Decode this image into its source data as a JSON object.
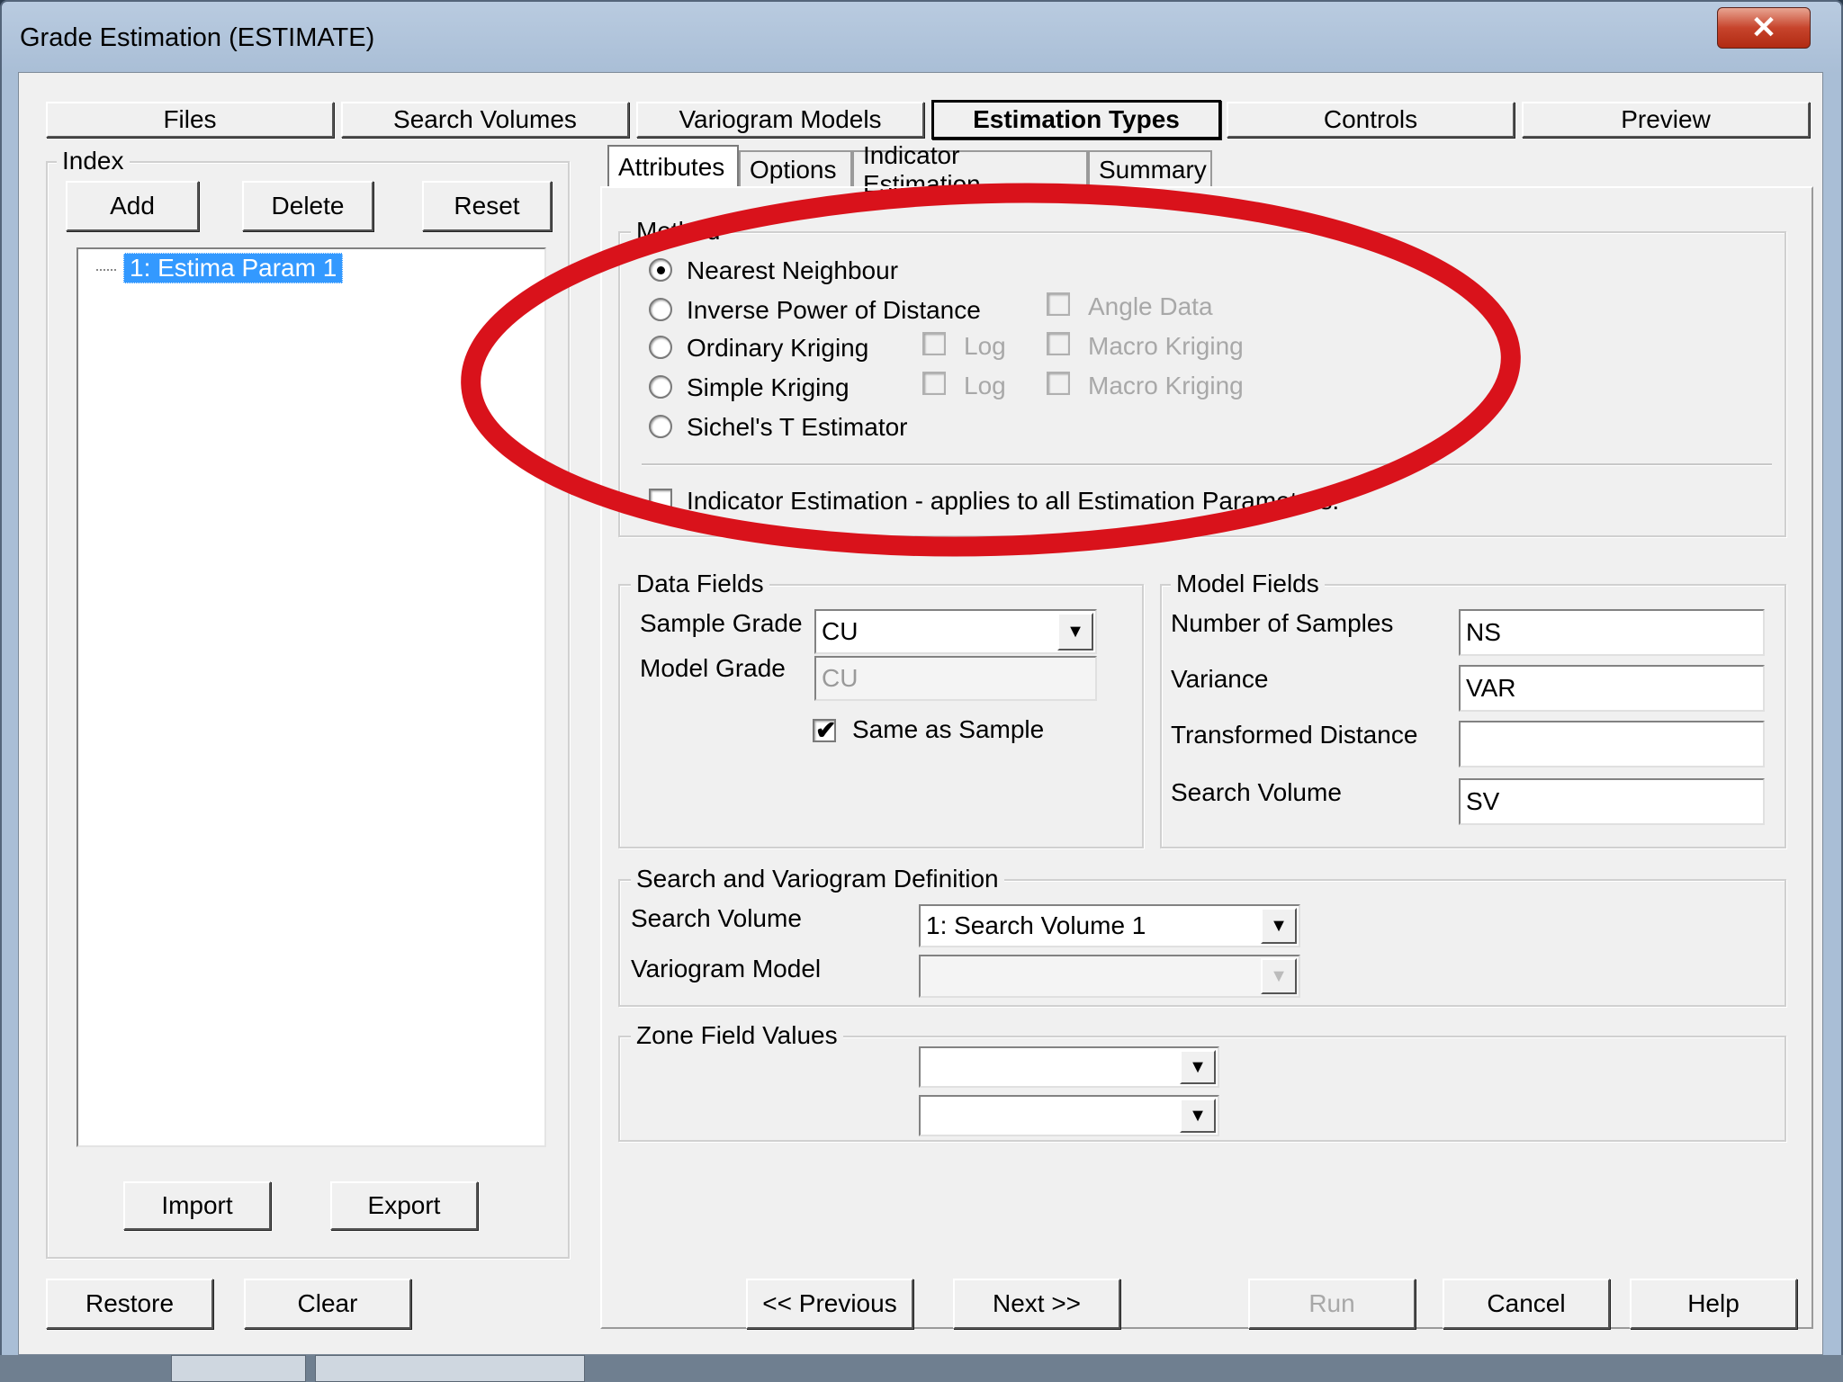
{
  "window": {
    "title": "Grade Estimation (ESTIMATE)",
    "close_glyph": "✕"
  },
  "main_tabs": [
    "Files",
    "Search Volumes",
    "Variogram Models",
    "Estimation Types",
    "Controls",
    "Preview"
  ],
  "index_panel": {
    "title": "Index",
    "add": "Add",
    "delete": "Delete",
    "reset": "Reset",
    "tree_item": "1: Estima Param 1",
    "import": "Import",
    "export": "Export"
  },
  "sub_tabs": [
    "Attributes",
    "Options",
    "Indicator Estimation",
    "Summary"
  ],
  "method": {
    "title": "Method",
    "nearest_neighbour": "Nearest Neighbour",
    "inverse_power": "Inverse Power of Distance",
    "ordinary_kriging": "Ordinary Kriging",
    "simple_kriging": "Simple Kriging",
    "sichels": "Sichel's T Estimator",
    "angle_data": "Angle Data",
    "log1": "Log",
    "log2": "Log",
    "macro1": "Macro Kriging",
    "macro2": "Macro Kriging",
    "indicator": "Indicator Estimation - applies to all Estimation Parameters.",
    "selected": "Nearest Neighbour"
  },
  "data_fields": {
    "title": "Data Fields",
    "sample_grade_label": "Sample Grade",
    "sample_grade_value": "CU",
    "model_grade_label": "Model Grade",
    "model_grade_value": "CU",
    "same_as_sample": "Same as Sample",
    "same_as_sample_checked": true
  },
  "model_fields": {
    "title": "Model Fields",
    "num_samples_label": "Number of Samples",
    "num_samples_value": "NS",
    "variance_label": "Variance",
    "variance_value": "VAR",
    "transformed_label": "Transformed Distance",
    "transformed_value": "",
    "search_volume_label": "Search Volume",
    "search_volume_value": "SV"
  },
  "search_variogram": {
    "title": "Search and Variogram Definition",
    "search_volume_label": "Search Volume",
    "search_volume_value": "1: Search Volume 1",
    "variogram_model_label": "Variogram Model",
    "variogram_model_value": ""
  },
  "zone_fields": {
    "title": "Zone Field Values"
  },
  "bottom_buttons": {
    "restore": "Restore",
    "clear": "Clear",
    "previous": "<< Previous",
    "next": "Next >>",
    "run": "Run",
    "cancel": "Cancel",
    "help": "Help"
  },
  "colors": {
    "annotation_red": "#d9121b",
    "selection_blue": "#3399ff"
  }
}
